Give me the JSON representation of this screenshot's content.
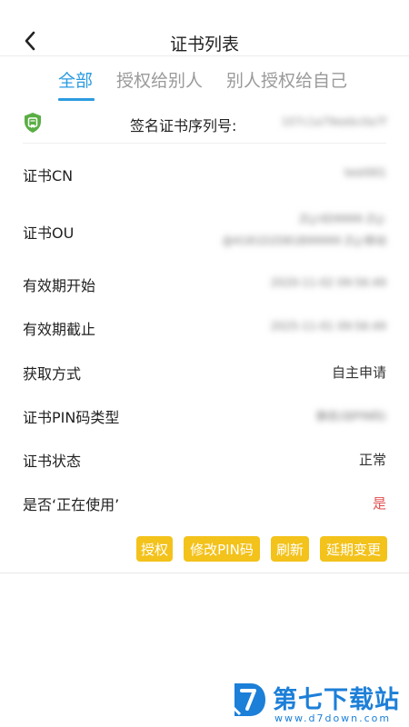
{
  "header": {
    "title": "证书列表"
  },
  "tabs": [
    {
      "label": "全部",
      "active": true
    },
    {
      "label": "授权给别人",
      "active": false
    },
    {
      "label": "别人授权给自己",
      "active": false
    }
  ],
  "serial": {
    "label": "签名证书序列号:",
    "value": "107c1a79eebc0a7f"
  },
  "details": [
    {
      "label": "证书CN",
      "value": "test001"
    },
    {
      "label": "证书OU",
      "value": "ZLJ-0D9999 ZLJ-",
      "value2": "@4181D2D81B99999 ZLJ-移动"
    },
    {
      "label": "有效期开始",
      "value": "2020-11-02 09:56:49"
    },
    {
      "label": "有效期截止",
      "value": "2025-11-01 09:56:49"
    },
    {
      "label": "获取方式",
      "value": "自主申请"
    },
    {
      "label": "证书PIN码类型",
      "value": "静态(动PIN码)"
    },
    {
      "label": "证书状态",
      "value": "正常"
    },
    {
      "label": "是否‘正在使用’",
      "value": "是"
    }
  ],
  "buttons": {
    "authorize": "授权",
    "modify_pin": "修改PIN码",
    "refresh": "刷新",
    "extend": "延期变更"
  },
  "colors": {
    "accent": "#2b9be0",
    "button": "#f3c21b",
    "danger": "#e05151",
    "watermark": "#1c7fd8"
  },
  "watermark": {
    "name": "第七下载站",
    "url": "www.d7down.com"
  }
}
